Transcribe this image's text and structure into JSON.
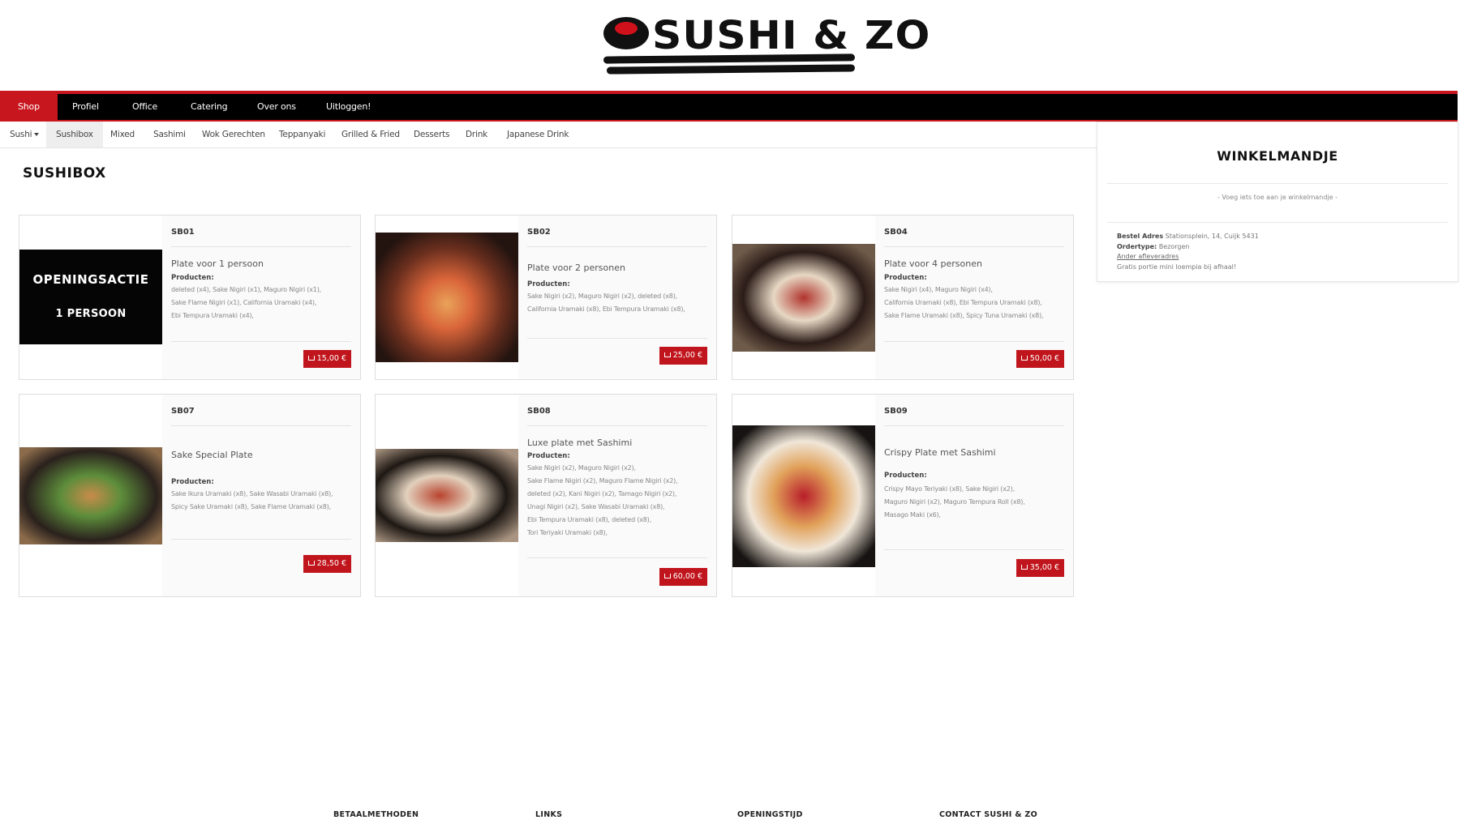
{
  "brand": {
    "logo_text": "SUSHI & ZO"
  },
  "main_nav": [
    {
      "label": "Shop",
      "active": true
    },
    {
      "label": "Profiel"
    },
    {
      "label": "Office"
    },
    {
      "label": "Catering"
    },
    {
      "label": "Over ons"
    },
    {
      "label": "Uitloggen!"
    }
  ],
  "sub_nav": [
    {
      "label": "Sushi"
    },
    {
      "label": "Sushibox",
      "active": true
    },
    {
      "label": "Mixed"
    },
    {
      "label": "Sashimi"
    },
    {
      "label": "Wok Gerechten"
    },
    {
      "label": "Teppanyaki"
    },
    {
      "label": "Grilled & Fried"
    },
    {
      "label": "Desserts"
    },
    {
      "label": "Drink"
    },
    {
      "label": "Japanese Drink"
    }
  ],
  "section_title": "SUSHIBOX",
  "products": [
    {
      "code": "SB01",
      "name": "Plate voor 1 persoon",
      "products_label": "Producten:",
      "items": "deleted (x4),   Sake Nigiri (x1),   Maguro Nigiri (x1),\nSake Flame Nigiri (x1),   California Uramaki (x4),\nEbi Tempura Uramaki (x4),",
      "price": "15,00 €",
      "image": {
        "line1": "OPENINGSACTIE",
        "line2": "1 PERSOON"
      }
    },
    {
      "code": "SB02",
      "name": "Plate voor 2 personen",
      "products_label": "Producten:",
      "items": "Sake Nigiri (x2),   Maguro Nigiri (x2),   deleted (x8),\nCalifornia Uramaki (x8),   Ebi Tempura Uramaki (x8),",
      "price": "25,00 €"
    },
    {
      "code": "SB04",
      "name": "Plate voor 4 personen",
      "products_label": "Producten:",
      "items": "Sake Nigiri (x4),   Maguro Nigiri (x4),\nCalifornia Uramaki (x8),   Ebi Tempura Uramaki (x8),\nSake Flame Uramaki (x8),   Spicy Tuna Uramaki (x8),",
      "price": "50,00 €"
    },
    {
      "code": "SB07",
      "name": "Sake Special Plate",
      "products_label": "Producten:",
      "items": "Sake Ikura Uramaki (x8),   Sake Wasabi Uramaki (x8),\nSpicy Sake Uramaki (x8),   Sake Flame Uramaki (x8),",
      "price": "28,50 €"
    },
    {
      "code": "SB08",
      "name": "Luxe plate met Sashimi",
      "products_label": "Producten:",
      "items": "Sake Nigiri (x2),   Maguro Nigiri (x2),\nSake Flame Nigiri (x2),   Maguro Flame Nigiri (x2),\ndeleted (x2),   Kani Nigiri (x2),   Tamago Nigiri (x2),\nUnagi Nigiri (x2),   Sake Wasabi Uramaki (x8),\nEbi Tempura Uramaki (x8),   deleted (x8),\nTori Teriyaki Uramaki (x8),",
      "price": "60,00 €"
    },
    {
      "code": "SB09",
      "name": "Crispy Plate met Sashimi",
      "products_label": "Producten:",
      "items": "Crispy Mayo Teriyaki (x8),   Sake Nigiri (x2),\nMaguro Nigiri (x2),   Maguro Tempura Roll (x8),\nMasago Maki (x6),",
      "price": "35,00 €"
    }
  ],
  "cart": {
    "title": "WINKELMANDJE",
    "empty_text": "- Voeg iets toe aan je winkelmandje -",
    "address_label": "Bestel Adres",
    "address_value": " Stationsplein, 14, Cuijk 5431",
    "ordertype_label": "Ordertype:",
    "ordertype_value": " Bezorgen",
    "other_address_link": "Ander afleveradres",
    "promo_note": "Gratis portie mini loempia bij afhaal!"
  },
  "footer": {
    "payment": "BETAALMETHODEN",
    "links": "LINKS",
    "hours": "OPENINGSTIJD",
    "contact": "CONTACT SUSHI & ZO"
  },
  "colors": {
    "brand_red": "#c8161e",
    "nav_black": "#000000",
    "price_red": "#c0151c"
  }
}
